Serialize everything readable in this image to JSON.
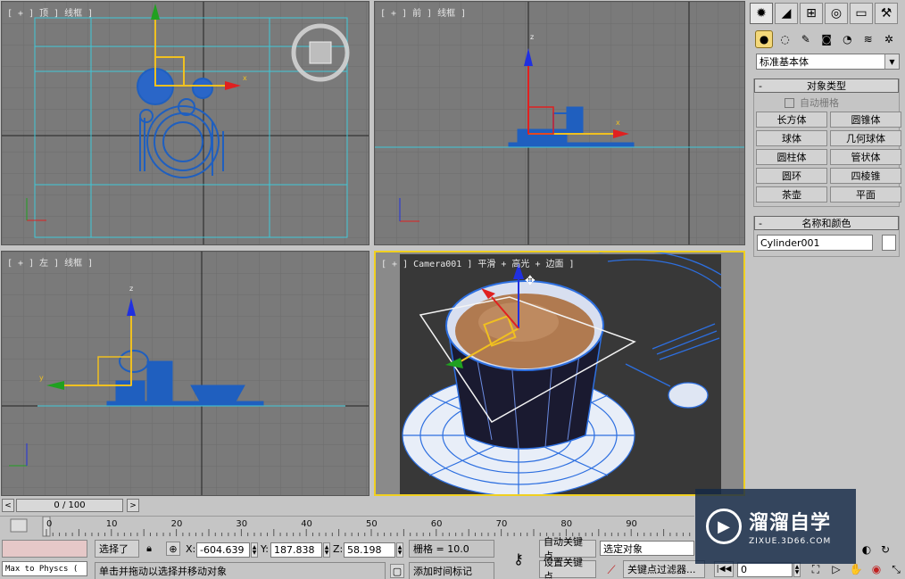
{
  "viewports": {
    "top": {
      "label": "[ + ] 顶 ] 线框 ]"
    },
    "front": {
      "label": "[ + ] 前 ] 线框 ]"
    },
    "left": {
      "label": "[ + ] 左 ] 线框 ]"
    },
    "camera": {
      "label": "[ + ] Camera001 ] 平滑 + 高光 + 边面 ]"
    }
  },
  "axes": {
    "x": "x",
    "y": "y",
    "z": "z"
  },
  "command_panel": {
    "tabs": [
      {
        "icon": "create-icon",
        "glyph": "✹"
      },
      {
        "icon": "modify-icon",
        "glyph": "◢"
      },
      {
        "icon": "hierarchy-icon",
        "glyph": "⊞"
      },
      {
        "icon": "motion-icon",
        "glyph": "◎"
      },
      {
        "icon": "display-icon",
        "glyph": "▭"
      },
      {
        "icon": "utilities-icon",
        "glyph": "⚒"
      }
    ],
    "subcategories": [
      {
        "icon": "geometry-icon",
        "glyph": "●"
      },
      {
        "icon": "shapes-icon",
        "glyph": "◌"
      },
      {
        "icon": "lights-icon",
        "glyph": "✎"
      },
      {
        "icon": "cameras-icon",
        "glyph": "◙"
      },
      {
        "icon": "helpers-icon",
        "glyph": "◔"
      },
      {
        "icon": "spacewarps-icon",
        "glyph": "≋"
      },
      {
        "icon": "systems-icon",
        "glyph": "✲"
      }
    ],
    "category_dropdown": "标准基本体",
    "object_type": {
      "title": "对象类型",
      "auto_grid": "自动栅格",
      "buttons": [
        "长方体",
        "圆锥体",
        "球体",
        "几何球体",
        "圆柱体",
        "管状体",
        "圆环",
        "四棱锥",
        "茶壶",
        "平面"
      ]
    },
    "name_color": {
      "title": "名称和颜色",
      "name": "Cylinder001"
    },
    "collapse_sign": "-"
  },
  "timeline": {
    "position": "0 / 100",
    "left_arrow": "<",
    "right_arrow": ">",
    "ticks": [
      "0",
      "10",
      "20",
      "30",
      "40",
      "50",
      "60",
      "70",
      "80",
      "90",
      "1"
    ]
  },
  "status": {
    "maxscript": "Max to Physcs (",
    "selection": "选择了",
    "prompt": "单击并拖动以选择并移动对象",
    "x_label": "X:",
    "x_value": "-604.639",
    "y_label": "Y:",
    "y_value": "187.838",
    "z_label": "Z:",
    "z_value": "58.198",
    "grid": "栅格 = 10.0",
    "add_time_tag": "添加时间标记",
    "auto_key": "自动关键点",
    "set_key": "设置关键点",
    "selected_object": "选定对象",
    "key_filters": "关键点过滤器...",
    "frame": "0"
  },
  "watermark": {
    "brand": "溜溜自学",
    "url": "ZIXUE.3D66.COM"
  },
  "colors": {
    "viewport_bg": "#7a7a7a",
    "active_border": "#f0d020",
    "object_blue": "#1f5fbf",
    "gizmo_yellow": "#f0c020",
    "axis_red": "#e02020",
    "axis_green": "#20a020",
    "axis_blue": "#2030e0",
    "guide_cyan": "#40c8d8"
  }
}
